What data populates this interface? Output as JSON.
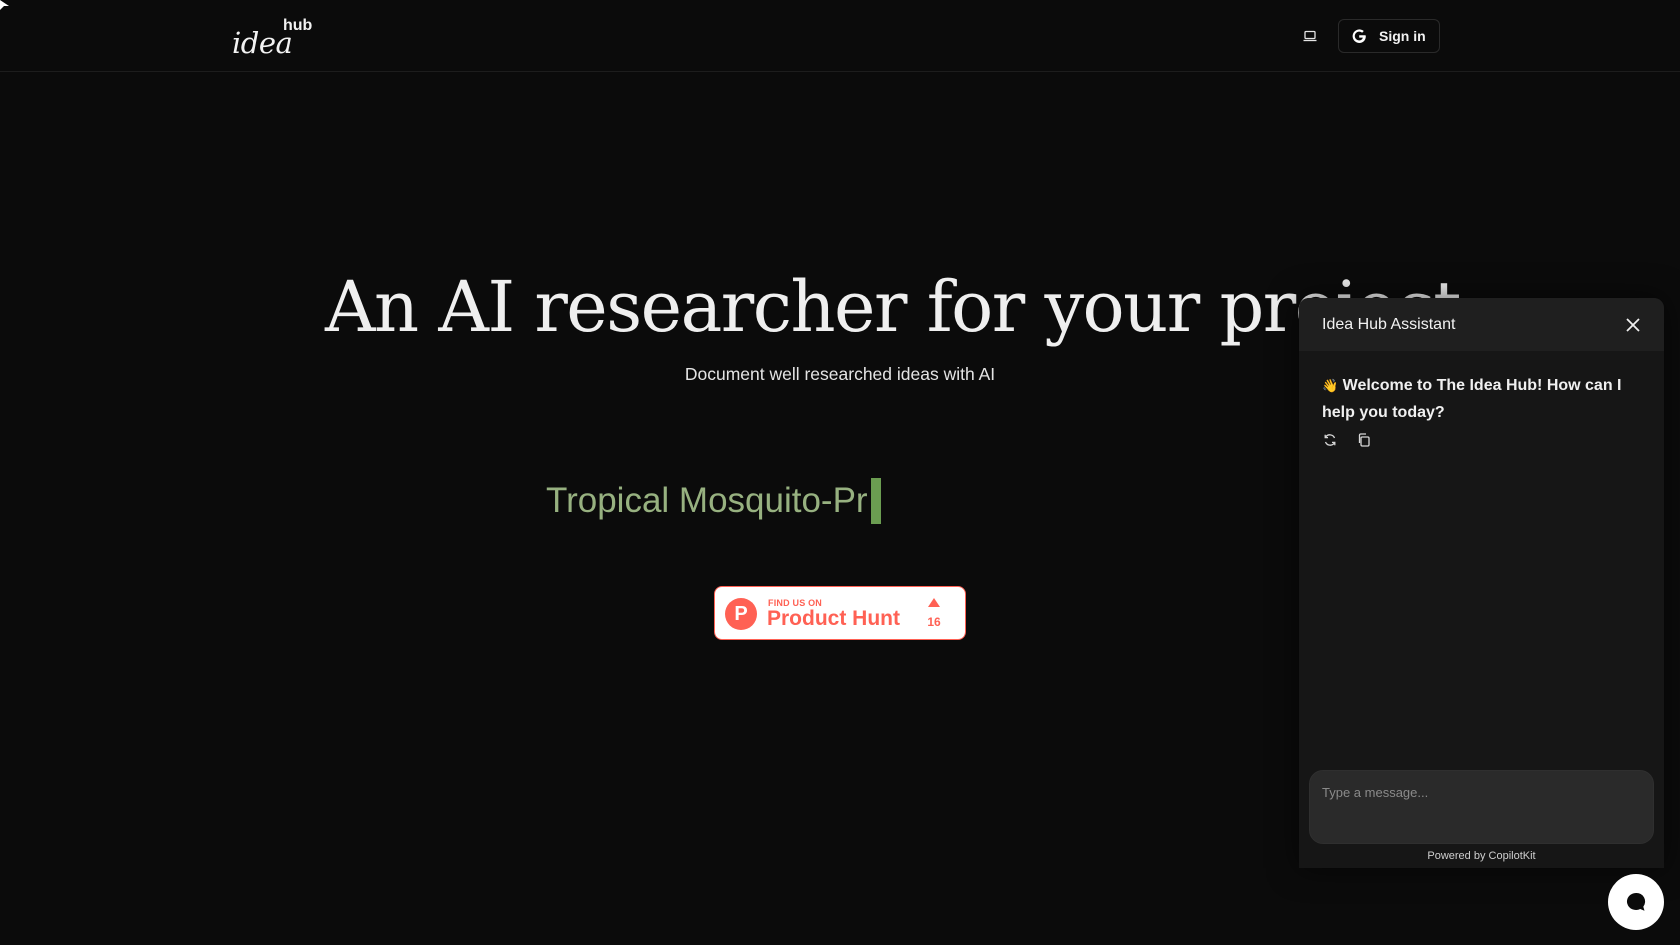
{
  "header": {
    "logo_main": "idea",
    "logo_sup": "hub",
    "signin_label": "Sign in"
  },
  "hero": {
    "title": "An AI researcher for your project",
    "subtitle": "Document well researched ideas with AI",
    "typing_text": "Tropical Mosquito-Pr"
  },
  "product_hunt": {
    "find_label": "FIND US ON",
    "name": "Product Hunt",
    "logo_letter": "P",
    "upvotes": "16"
  },
  "assistant": {
    "title": "Idea Hub Assistant",
    "welcome_emoji": "👋",
    "welcome_message": "Welcome to The Idea Hub! How can I help you today?",
    "input_placeholder": "Type a message...",
    "powered_by": "Powered by CopilotKit"
  },
  "icons": {
    "laptop": "laptop-icon",
    "google": "google-icon",
    "close": "close-icon",
    "regenerate": "refresh-icon",
    "copy": "copy-icon",
    "chat": "chat-bubble-icon"
  },
  "colors": {
    "background": "#0b0b0b",
    "typing_text": "#97b180",
    "cursor": "#6b9d51",
    "product_hunt": "#ff6154",
    "panel": "#161616"
  }
}
